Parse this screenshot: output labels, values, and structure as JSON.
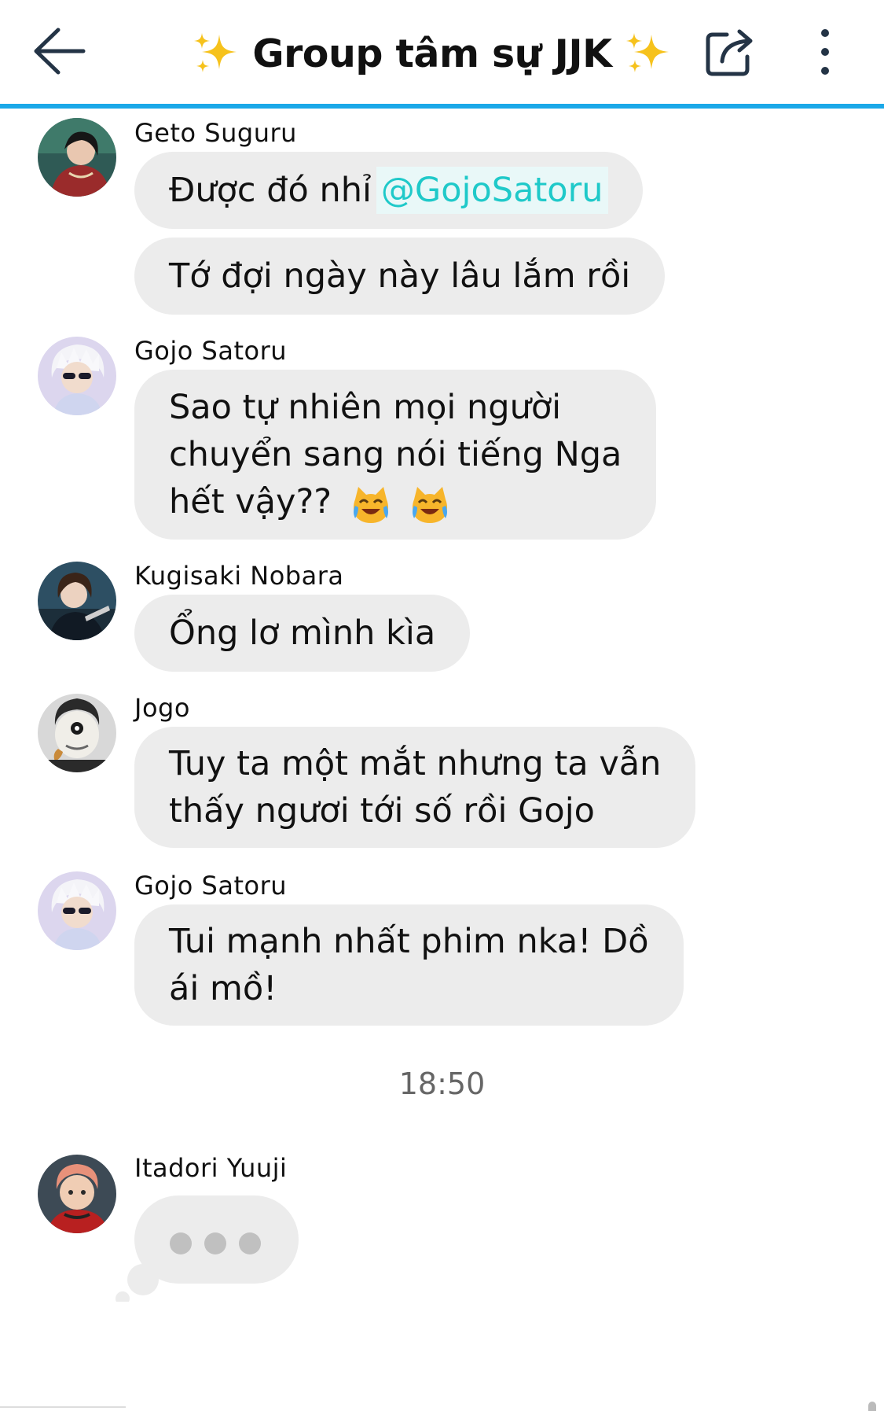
{
  "header": {
    "title": "Group tâm sự JJK",
    "icons": [
      "back-arrow-icon",
      "sparkles-icon",
      "share-icon",
      "more-vertical-icon"
    ],
    "accent_color": "#1ba8e8"
  },
  "messages": [
    {
      "sender": "Geto Suguru",
      "avatar": "geto-avatar",
      "bubbles": [
        {
          "text": "Được đó nhỉ",
          "mention": "@GojoSatoru"
        },
        {
          "text": "Tớ đợi ngày này lâu lắm rồi"
        }
      ]
    },
    {
      "sender": "Gojo Satoru",
      "avatar": "gojo-avatar",
      "bubbles": [
        {
          "lines": [
            "Sao tự nhiên mọi người",
            "chuyển sang nói tiếng Nga",
            "hết vậy??"
          ],
          "emoji": "crying-laughing-cat-emoji"
        }
      ]
    },
    {
      "sender": "Kugisaki Nobara",
      "avatar": "nobara-avatar",
      "bubbles": [
        {
          "text": "Ổng lơ mình kìa"
        }
      ]
    },
    {
      "sender": "Jogo",
      "avatar": "jogo-avatar",
      "bubbles": [
        {
          "lines": [
            "Tuy ta một mắt nhưng ta vẫn",
            "thấy ngươi tới số rồi Gojo"
          ]
        }
      ]
    },
    {
      "sender": "Gojo Satoru",
      "avatar": "gojo-avatar",
      "bubbles": [
        {
          "lines": [
            "Tui mạnh nhất phim nka! Dồ",
            "ái mồ!"
          ]
        }
      ]
    }
  ],
  "timestamp": "18:50",
  "typing": {
    "sender": "Itadori Yuuji",
    "avatar": "itadori-avatar",
    "indicator": "typing-dots"
  },
  "colors": {
    "bubble": "#ececec",
    "mention": "#1fc9c9",
    "timestamp": "#666666"
  }
}
